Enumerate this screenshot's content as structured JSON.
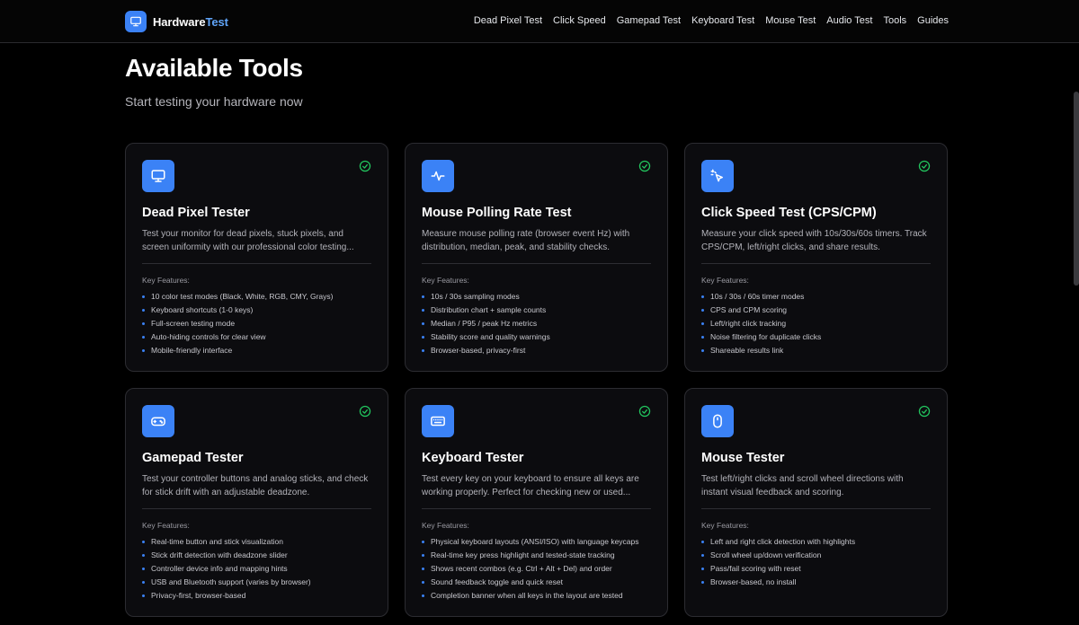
{
  "brand": {
    "name_prefix": "Hardware",
    "name_accent": "Test",
    "icon": "monitor-icon"
  },
  "nav": [
    {
      "label": "Dead Pixel Test"
    },
    {
      "label": "Click Speed"
    },
    {
      "label": "Gamepad Test"
    },
    {
      "label": "Keyboard Test"
    },
    {
      "label": "Mouse Test"
    },
    {
      "label": "Audio Test"
    },
    {
      "label": "Tools"
    },
    {
      "label": "Guides"
    }
  ],
  "hero": {
    "title": "Available Tools",
    "subtitle": "Start testing your hardware now"
  },
  "key_features_label": "Key Features:",
  "colors": {
    "accent": "#3b82f6",
    "check": "#22c55e",
    "background": "#000000",
    "card": "#0c0c0f"
  },
  "cards": [
    {
      "icon": "monitor-icon",
      "title": "Dead Pixel Tester",
      "description": "Test your monitor for dead pixels, stuck pixels, and screen uniformity with our professional color testing...",
      "features": [
        "10 color test modes (Black, White, RGB, CMY, Grays)",
        "Keyboard shortcuts (1-0 keys)",
        "Full-screen testing mode",
        "Auto-hiding controls for clear view",
        "Mobile-friendly interface"
      ]
    },
    {
      "icon": "activity-icon",
      "title": "Mouse Polling Rate Test",
      "description": "Measure mouse polling rate (browser event Hz) with distribution, median, peak, and stability checks.",
      "features": [
        "10s / 30s sampling modes",
        "Distribution chart + sample counts",
        "Median / P95 / peak Hz metrics",
        "Stability score and quality warnings",
        "Browser-based, privacy-first"
      ]
    },
    {
      "icon": "pointer-click-icon",
      "title": "Click Speed Test (CPS/CPM)",
      "description": "Measure your click speed with 10s/30s/60s timers. Track CPS/CPM, left/right clicks, and share results.",
      "features": [
        "10s / 30s / 60s timer modes",
        "CPS and CPM scoring",
        "Left/right click tracking",
        "Noise filtering for duplicate clicks",
        "Shareable results link"
      ]
    },
    {
      "icon": "gamepad-icon",
      "title": "Gamepad Tester",
      "description": "Test your controller buttons and analog sticks, and check for stick drift with an adjustable deadzone.",
      "features": [
        "Real-time button and stick visualization",
        "Stick drift detection with deadzone slider",
        "Controller device info and mapping hints",
        "USB and Bluetooth support (varies by browser)",
        "Privacy-first, browser-based"
      ]
    },
    {
      "icon": "keyboard-icon",
      "title": "Keyboard Tester",
      "description": "Test every key on your keyboard to ensure all keys are working properly. Perfect for checking new or used...",
      "features": [
        "Physical keyboard layouts (ANSI/ISO) with language keycaps",
        "Real-time key press highlight and tested-state tracking",
        "Shows recent combos (e.g. Ctrl + Alt + Del) and order",
        "Sound feedback toggle and quick reset",
        "Completion banner when all keys in the layout are tested"
      ]
    },
    {
      "icon": "mouse-icon",
      "title": "Mouse Tester",
      "description": "Test left/right clicks and scroll wheel directions with instant visual feedback and scoring.",
      "features": [
        "Left and right click detection with highlights",
        "Scroll wheel up/down verification",
        "Pass/fail scoring with reset",
        "Browser-based, no install"
      ]
    }
  ]
}
